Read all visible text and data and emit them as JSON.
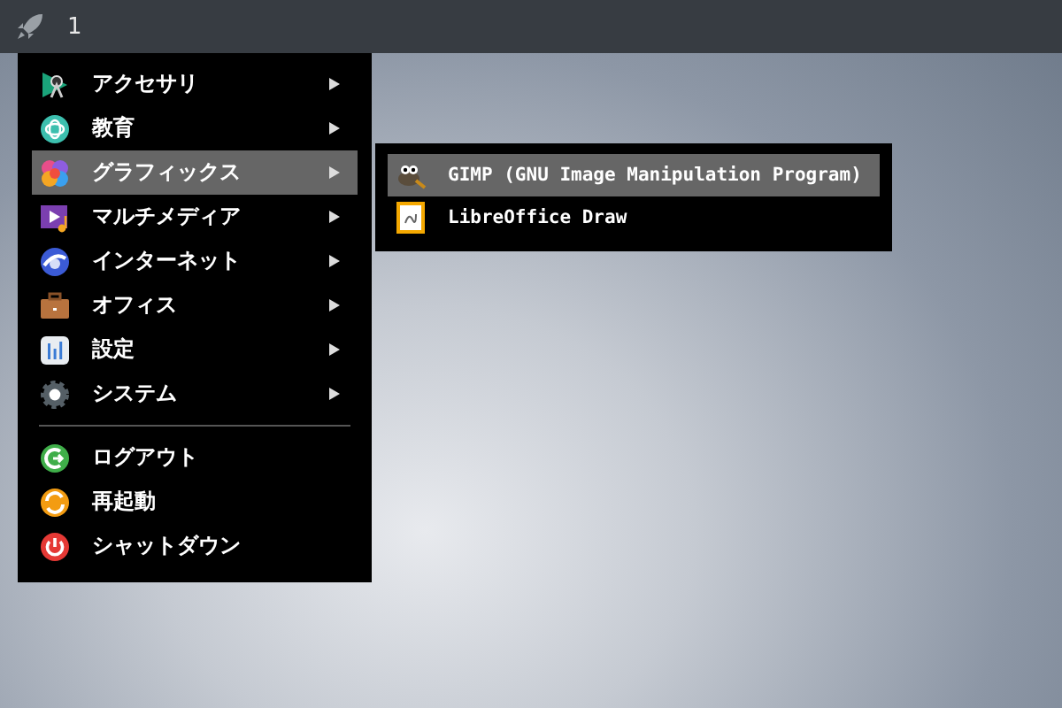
{
  "taskbar": {
    "workspace": "1"
  },
  "menu": {
    "items": [
      {
        "label": "アクセサリ",
        "submenu": true,
        "selected": false
      },
      {
        "label": "教育",
        "submenu": true,
        "selected": false
      },
      {
        "label": "グラフィックス",
        "submenu": true,
        "selected": true
      },
      {
        "label": "マルチメディア",
        "submenu": true,
        "selected": false
      },
      {
        "label": "インターネット",
        "submenu": true,
        "selected": false
      },
      {
        "label": "オフィス",
        "submenu": true,
        "selected": false
      },
      {
        "label": "設定",
        "submenu": true,
        "selected": false
      },
      {
        "label": "システム",
        "submenu": true,
        "selected": false
      }
    ],
    "session_items": [
      {
        "label": "ログアウト",
        "selected": false
      },
      {
        "label": "再起動",
        "selected": false
      },
      {
        "label": "シャットダウン",
        "selected": false
      }
    ]
  },
  "submenu": {
    "items": [
      {
        "label": "GIMP (GNU Image Manipulation Program)",
        "selected": true
      },
      {
        "label": "LibreOffice Draw",
        "selected": false
      }
    ]
  }
}
